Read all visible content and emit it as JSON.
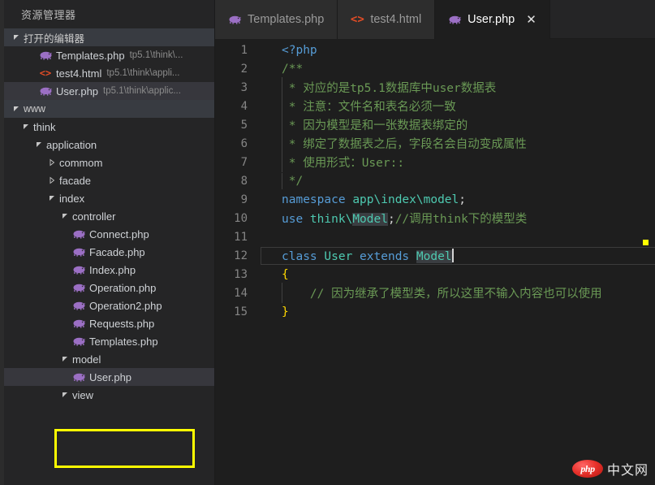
{
  "window": {
    "theme": "dark-plus",
    "accent_annotation_color": "#ffff00"
  },
  "sidebar": {
    "title": "资源管理器",
    "open_editors": {
      "header_label": "打开的编辑器",
      "expanded": true,
      "items": [
        {
          "icon": "php-file-icon",
          "name": "Templates.php",
          "path": "tp5.1\\think\\...",
          "selected": false
        },
        {
          "icon": "html-file-icon",
          "name": "test4.html",
          "path": "tp5.1\\think\\appli...",
          "selected": false
        },
        {
          "icon": "php-file-icon",
          "name": "User.php",
          "path": "tp5.1\\think\\applic...",
          "selected": true
        }
      ]
    },
    "workspace": {
      "header_label": "www",
      "expanded": true,
      "tree": [
        {
          "label": "think",
          "type": "folder",
          "depth": 1,
          "expanded": true,
          "selected": false,
          "highlighted": false
        },
        {
          "label": "application",
          "type": "folder",
          "depth": 2,
          "expanded": true,
          "selected": false,
          "highlighted": false
        },
        {
          "label": "commom",
          "type": "folder",
          "depth": 3,
          "expanded": false,
          "selected": false,
          "highlighted": false
        },
        {
          "label": "facade",
          "type": "folder",
          "depth": 3,
          "expanded": false,
          "selected": false,
          "highlighted": false
        },
        {
          "label": "index",
          "type": "folder",
          "depth": 3,
          "expanded": true,
          "selected": false,
          "highlighted": false
        },
        {
          "label": "controller",
          "type": "folder",
          "depth": 4,
          "expanded": true,
          "selected": false,
          "highlighted": false
        },
        {
          "label": "Connect.php",
          "type": "php",
          "depth": 5,
          "expanded": null,
          "selected": false,
          "highlighted": false
        },
        {
          "label": "Facade.php",
          "type": "php",
          "depth": 5,
          "expanded": null,
          "selected": false,
          "highlighted": false
        },
        {
          "label": "Index.php",
          "type": "php",
          "depth": 5,
          "expanded": null,
          "selected": false,
          "highlighted": false
        },
        {
          "label": "Operation.php",
          "type": "php",
          "depth": 5,
          "expanded": null,
          "selected": false,
          "highlighted": false
        },
        {
          "label": "Operation2.php",
          "type": "php",
          "depth": 5,
          "expanded": null,
          "selected": false,
          "highlighted": false
        },
        {
          "label": "Requests.php",
          "type": "php",
          "depth": 5,
          "expanded": null,
          "selected": false,
          "highlighted": false
        },
        {
          "label": "Templates.php",
          "type": "php",
          "depth": 5,
          "expanded": null,
          "selected": false,
          "highlighted": false
        },
        {
          "label": "model",
          "type": "folder",
          "depth": 4,
          "expanded": true,
          "selected": false,
          "highlighted": true
        },
        {
          "label": "User.php",
          "type": "php",
          "depth": 5,
          "expanded": null,
          "selected": true,
          "highlighted": true
        },
        {
          "label": "view",
          "type": "folder",
          "depth": 4,
          "expanded": true,
          "selected": false,
          "highlighted": false
        }
      ]
    }
  },
  "editor": {
    "tabs": [
      {
        "icon": "php-file-icon",
        "label": "Templates.php",
        "active": false,
        "closable": false
      },
      {
        "icon": "html-file-icon",
        "label": "test4.html",
        "active": false,
        "closable": false
      },
      {
        "icon": "php-file-icon",
        "label": "User.php",
        "active": true,
        "closable": true,
        "close_glyph": "✕"
      }
    ],
    "active_file": "User.php",
    "language": "php",
    "cursor_line": 12,
    "selected_word": "Model",
    "overview_marker_color": "#ffff00",
    "code": [
      {
        "n": 1,
        "tokens": [
          {
            "t": "<?php",
            "c": "t-tag"
          }
        ]
      },
      {
        "n": 2,
        "tokens": [
          {
            "t": "/**",
            "c": "t-comment"
          }
        ]
      },
      {
        "n": 3,
        "tokens": [
          {
            "t": " * 对应的是tp5.1数据库中user数据表",
            "c": "t-comment"
          }
        ]
      },
      {
        "n": 4,
        "tokens": [
          {
            "t": " * 注意：文件名和表名必须一致",
            "c": "t-comment"
          }
        ]
      },
      {
        "n": 5,
        "tokens": [
          {
            "t": " * 因为模型是和一张数据表绑定的",
            "c": "t-comment"
          }
        ]
      },
      {
        "n": 6,
        "tokens": [
          {
            "t": " * 绑定了数据表之后，字段名会自动变成属性",
            "c": "t-comment"
          }
        ]
      },
      {
        "n": 7,
        "tokens": [
          {
            "t": " * 使用形式：User::",
            "c": "t-comment"
          }
        ]
      },
      {
        "n": 8,
        "tokens": [
          {
            "t": " */",
            "c": "t-comment"
          }
        ]
      },
      {
        "n": 9,
        "tokens": [
          {
            "t": "namespace ",
            "c": "t-keyword"
          },
          {
            "t": "app\\index\\model",
            "c": "t-ns"
          },
          {
            "t": ";",
            "c": "t-punct"
          }
        ]
      },
      {
        "n": 10,
        "tokens": [
          {
            "t": "use ",
            "c": "t-keyword"
          },
          {
            "t": "think\\",
            "c": "t-ns"
          },
          {
            "t": "Model",
            "c": "t-ns sel-word"
          },
          {
            "t": ";",
            "c": "t-punct"
          },
          {
            "t": "//调用think下的模型类",
            "c": "t-comment"
          }
        ]
      },
      {
        "n": 11,
        "tokens": []
      },
      {
        "n": 12,
        "tokens": [
          {
            "t": "class ",
            "c": "t-keyword"
          },
          {
            "t": "User",
            "c": "t-class"
          },
          {
            "t": " extends ",
            "c": "t-keyword"
          },
          {
            "t": "Model",
            "c": "t-class sel-word"
          }
        ]
      },
      {
        "n": 13,
        "tokens": [
          {
            "t": "{",
            "c": "t-brace"
          }
        ]
      },
      {
        "n": 14,
        "tokens": [
          {
            "t": "    // 因为继承了模型类，所以这里不输入内容也可以使用",
            "c": "t-comment"
          }
        ]
      },
      {
        "n": 15,
        "tokens": [
          {
            "t": "}",
            "c": "t-brace"
          }
        ]
      }
    ]
  },
  "watermark": {
    "logo_text": "php",
    "text": "中文网"
  }
}
